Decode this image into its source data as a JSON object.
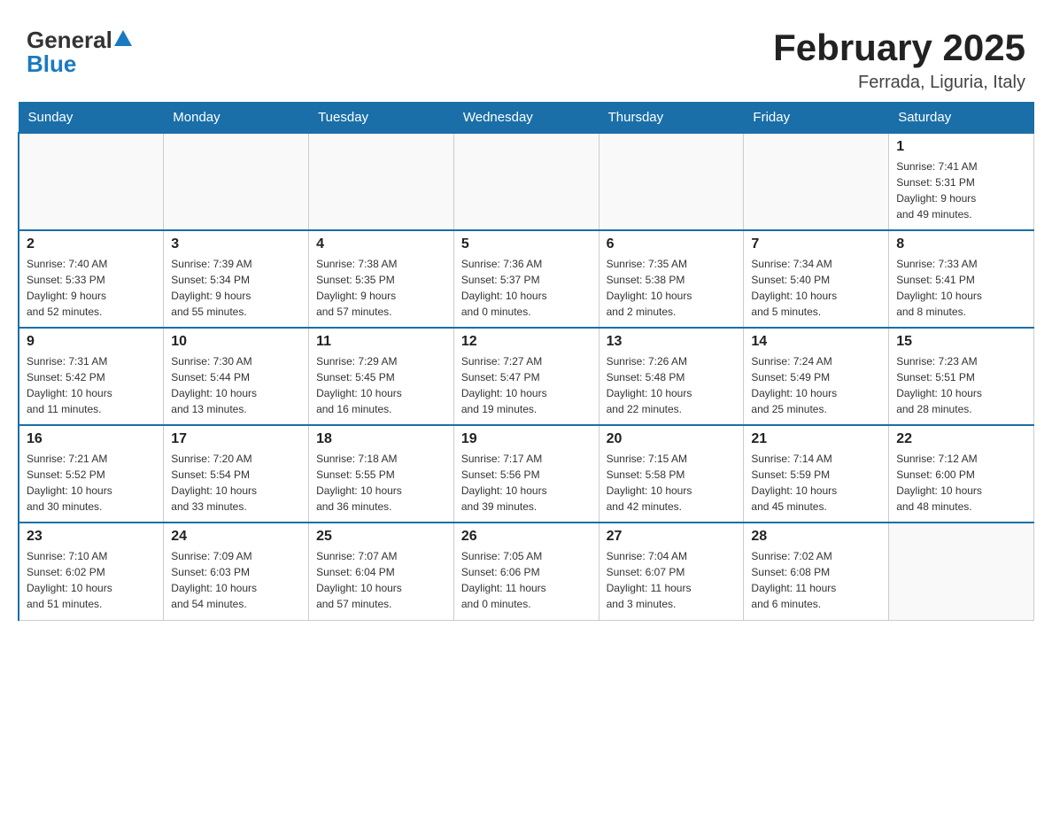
{
  "header": {
    "logo_general": "General",
    "logo_blue": "Blue",
    "month_title": "February 2025",
    "location": "Ferrada, Liguria, Italy"
  },
  "days_of_week": [
    "Sunday",
    "Monday",
    "Tuesday",
    "Wednesday",
    "Thursday",
    "Friday",
    "Saturday"
  ],
  "weeks": [
    [
      {
        "day": "",
        "info": ""
      },
      {
        "day": "",
        "info": ""
      },
      {
        "day": "",
        "info": ""
      },
      {
        "day": "",
        "info": ""
      },
      {
        "day": "",
        "info": ""
      },
      {
        "day": "",
        "info": ""
      },
      {
        "day": "1",
        "info": "Sunrise: 7:41 AM\nSunset: 5:31 PM\nDaylight: 9 hours\nand 49 minutes."
      }
    ],
    [
      {
        "day": "2",
        "info": "Sunrise: 7:40 AM\nSunset: 5:33 PM\nDaylight: 9 hours\nand 52 minutes."
      },
      {
        "day": "3",
        "info": "Sunrise: 7:39 AM\nSunset: 5:34 PM\nDaylight: 9 hours\nand 55 minutes."
      },
      {
        "day": "4",
        "info": "Sunrise: 7:38 AM\nSunset: 5:35 PM\nDaylight: 9 hours\nand 57 minutes."
      },
      {
        "day": "5",
        "info": "Sunrise: 7:36 AM\nSunset: 5:37 PM\nDaylight: 10 hours\nand 0 minutes."
      },
      {
        "day": "6",
        "info": "Sunrise: 7:35 AM\nSunset: 5:38 PM\nDaylight: 10 hours\nand 2 minutes."
      },
      {
        "day": "7",
        "info": "Sunrise: 7:34 AM\nSunset: 5:40 PM\nDaylight: 10 hours\nand 5 minutes."
      },
      {
        "day": "8",
        "info": "Sunrise: 7:33 AM\nSunset: 5:41 PM\nDaylight: 10 hours\nand 8 minutes."
      }
    ],
    [
      {
        "day": "9",
        "info": "Sunrise: 7:31 AM\nSunset: 5:42 PM\nDaylight: 10 hours\nand 11 minutes."
      },
      {
        "day": "10",
        "info": "Sunrise: 7:30 AM\nSunset: 5:44 PM\nDaylight: 10 hours\nand 13 minutes."
      },
      {
        "day": "11",
        "info": "Sunrise: 7:29 AM\nSunset: 5:45 PM\nDaylight: 10 hours\nand 16 minutes."
      },
      {
        "day": "12",
        "info": "Sunrise: 7:27 AM\nSunset: 5:47 PM\nDaylight: 10 hours\nand 19 minutes."
      },
      {
        "day": "13",
        "info": "Sunrise: 7:26 AM\nSunset: 5:48 PM\nDaylight: 10 hours\nand 22 minutes."
      },
      {
        "day": "14",
        "info": "Sunrise: 7:24 AM\nSunset: 5:49 PM\nDaylight: 10 hours\nand 25 minutes."
      },
      {
        "day": "15",
        "info": "Sunrise: 7:23 AM\nSunset: 5:51 PM\nDaylight: 10 hours\nand 28 minutes."
      }
    ],
    [
      {
        "day": "16",
        "info": "Sunrise: 7:21 AM\nSunset: 5:52 PM\nDaylight: 10 hours\nand 30 minutes."
      },
      {
        "day": "17",
        "info": "Sunrise: 7:20 AM\nSunset: 5:54 PM\nDaylight: 10 hours\nand 33 minutes."
      },
      {
        "day": "18",
        "info": "Sunrise: 7:18 AM\nSunset: 5:55 PM\nDaylight: 10 hours\nand 36 minutes."
      },
      {
        "day": "19",
        "info": "Sunrise: 7:17 AM\nSunset: 5:56 PM\nDaylight: 10 hours\nand 39 minutes."
      },
      {
        "day": "20",
        "info": "Sunrise: 7:15 AM\nSunset: 5:58 PM\nDaylight: 10 hours\nand 42 minutes."
      },
      {
        "day": "21",
        "info": "Sunrise: 7:14 AM\nSunset: 5:59 PM\nDaylight: 10 hours\nand 45 minutes."
      },
      {
        "day": "22",
        "info": "Sunrise: 7:12 AM\nSunset: 6:00 PM\nDaylight: 10 hours\nand 48 minutes."
      }
    ],
    [
      {
        "day": "23",
        "info": "Sunrise: 7:10 AM\nSunset: 6:02 PM\nDaylight: 10 hours\nand 51 minutes."
      },
      {
        "day": "24",
        "info": "Sunrise: 7:09 AM\nSunset: 6:03 PM\nDaylight: 10 hours\nand 54 minutes."
      },
      {
        "day": "25",
        "info": "Sunrise: 7:07 AM\nSunset: 6:04 PM\nDaylight: 10 hours\nand 57 minutes."
      },
      {
        "day": "26",
        "info": "Sunrise: 7:05 AM\nSunset: 6:06 PM\nDaylight: 11 hours\nand 0 minutes."
      },
      {
        "day": "27",
        "info": "Sunrise: 7:04 AM\nSunset: 6:07 PM\nDaylight: 11 hours\nand 3 minutes."
      },
      {
        "day": "28",
        "info": "Sunrise: 7:02 AM\nSunset: 6:08 PM\nDaylight: 11 hours\nand 6 minutes."
      },
      {
        "day": "",
        "info": ""
      }
    ]
  ]
}
